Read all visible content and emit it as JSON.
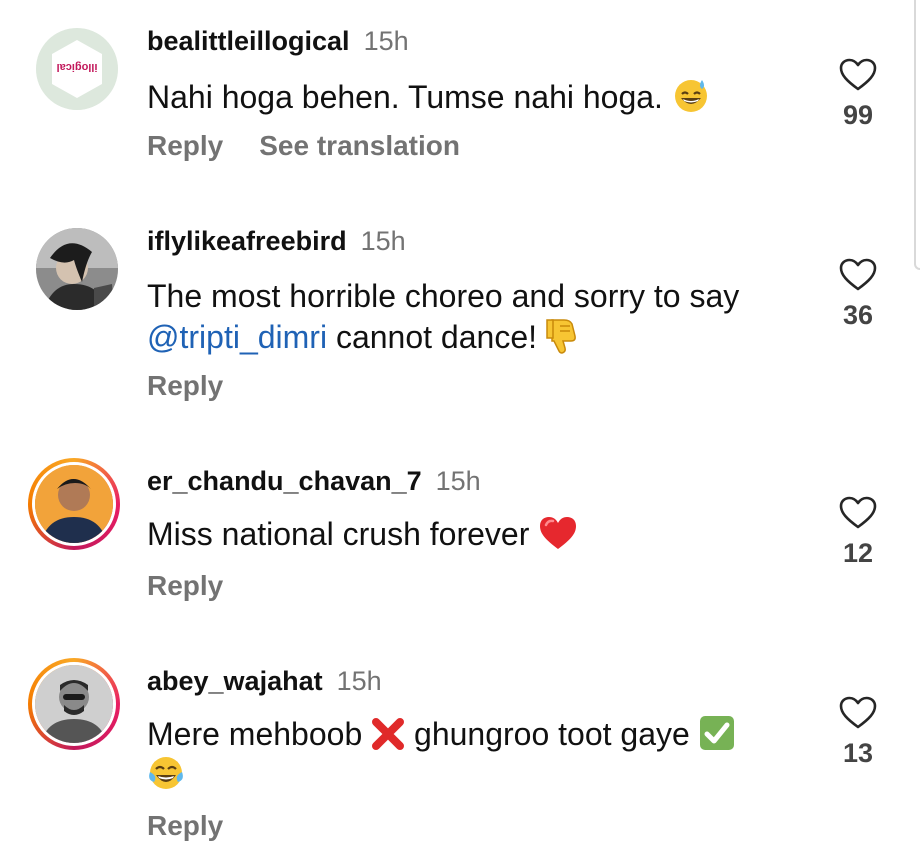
{
  "comments": [
    {
      "username": "bealittleillogical",
      "time": "15h",
      "text": "Nahi hoga behen. Tumse nahi hoga.",
      "avatar_logo_text": "illogical",
      "actions": {
        "reply": "Reply",
        "translate": "See translation"
      },
      "likes": "99"
    },
    {
      "username": "iflylikeafreebird",
      "time": "15h",
      "text_before": "The most horrible choreo and sorry to say",
      "mention": "@tripti_dimri",
      "text_after": "cannot dance!",
      "actions": {
        "reply": "Reply"
      },
      "likes": "36"
    },
    {
      "username": "er_chandu_chavan_7",
      "time": "15h",
      "text": "Miss national crush forever",
      "actions": {
        "reply": "Reply"
      },
      "likes": "12"
    },
    {
      "username": "abey_wajahat",
      "time": "15h",
      "text_part1": "Mere mehboob",
      "text_part2": "ghungroo toot gaye",
      "actions": {
        "reply": "Reply"
      },
      "likes": "13"
    }
  ],
  "colors": {
    "mention": "#1f62b5",
    "secondary_text": "#737373",
    "story_ring_start": "#f9a825",
    "story_ring_end": "#c2185b"
  }
}
